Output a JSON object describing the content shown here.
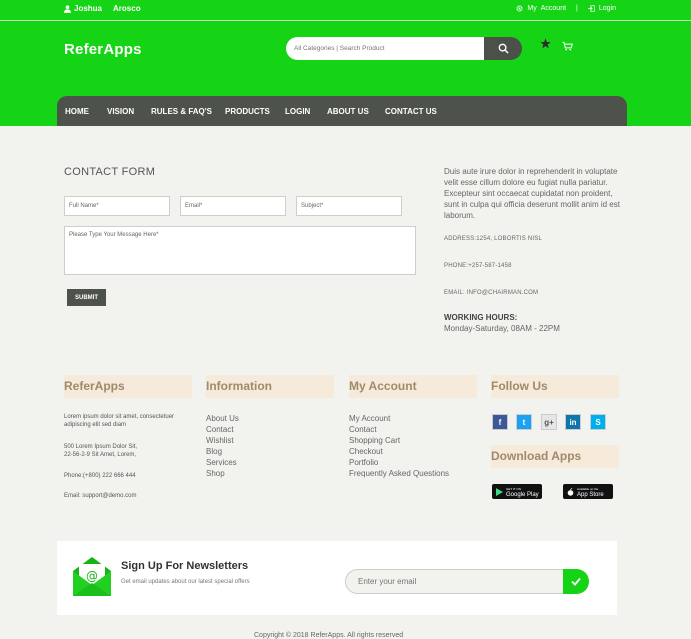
{
  "colors": {
    "brand_green": "#15d315",
    "nav_dark": "#4d534a",
    "heading_bg": "#f6eadb",
    "heading_text": "#a08a6a"
  },
  "topbar": {
    "user_first": "Joshua",
    "user_last": "Arosco",
    "my": "My",
    "account": "Account",
    "login": "Login"
  },
  "header": {
    "logo": "ReferApps",
    "search_placeholder": "All Categories | Search Product"
  },
  "nav": {
    "items": [
      {
        "label": "HOME"
      },
      {
        "label": "VISION"
      },
      {
        "label": "RULES & FAQ'S"
      },
      {
        "label": "PRODUCTS"
      },
      {
        "label": "LOGIN"
      },
      {
        "label": "ABOUT US"
      },
      {
        "label": "CONTACT US"
      }
    ]
  },
  "contact_form": {
    "title": "CONTACT FORM",
    "full_name_placeholder": "Full Name*",
    "email_placeholder": "Email*",
    "subject_placeholder": "Subject*",
    "message_placeholder": "Please Type Your Message Here*",
    "submit_label": "SUBMIT"
  },
  "contact_info": {
    "paragraph": "Duis aute irure dolor in reprehenderit in voluptate velit esse cillum dolore eu fugiat nulla pariatur. Excepteur sint occaecat cupidatat non proident, sunt in culpa qui officia deserunt mollit anim id est laborum.",
    "address": "ADDRESS:1254, LOBORTIS NISL",
    "phone": "PHONE:+257-587-1458",
    "email": "EMAIL: INFO@CHAIRMAN.COM",
    "working_hours_label": "WORKING HOURS:",
    "working_hours_value": "Monday-Saturday, 08AM - 22PM"
  },
  "footer": {
    "col1": {
      "heading": "ReferApps",
      "about": "Lorem ipsum dolor sit amet, consectetuer adipiscing elit sed diam",
      "address_line1": "500 Lorem Ipsum Dolor Sit,",
      "address_line2": "22-56-2-9 Sit Amet, Lorem,",
      "phone": "Phone:(+800) 222 666 444",
      "email": "Email: support@demo.com"
    },
    "col2": {
      "heading": "Information",
      "links": [
        {
          "label": "About Us"
        },
        {
          "label": "Contact"
        },
        {
          "label": "Wishlist"
        },
        {
          "label": "Blog"
        },
        {
          "label": "Services"
        },
        {
          "label": "Shop"
        }
      ]
    },
    "col3": {
      "heading": "My Account",
      "links": [
        {
          "label": "My Account"
        },
        {
          "label": "Contact"
        },
        {
          "label": "Shopping Cart"
        },
        {
          "label": "Checkout"
        },
        {
          "label": "Portfolio"
        },
        {
          "label": "Frequently Asked Questions"
        }
      ]
    },
    "col4": {
      "heading": "Follow Us",
      "social": [
        {
          "icon": "facebook-icon",
          "glyph": "f",
          "color": "#3b5998"
        },
        {
          "icon": "twitter-icon",
          "glyph": "t",
          "color": "#1da1f2"
        },
        {
          "icon": "google-plus-icon",
          "glyph": "g+",
          "color": "#e6e6e6"
        },
        {
          "icon": "linkedin-icon",
          "glyph": "in",
          "color": "#0e76a8"
        },
        {
          "icon": "skype-icon",
          "glyph": "S",
          "color": "#00aff0"
        }
      ],
      "download_heading": "Download Apps",
      "google_play_small": "GET IT ON",
      "google_play": "Google Play",
      "app_store_small": "Available on the",
      "app_store": "App Store"
    }
  },
  "newsletter": {
    "title": "Sign Up For Newsletters",
    "subtitle": "Get email updates about our latest special offers",
    "input_placeholder": "Enter your email"
  },
  "copyright": "Copyright © 2018 ReferApps. All rights reserved"
}
